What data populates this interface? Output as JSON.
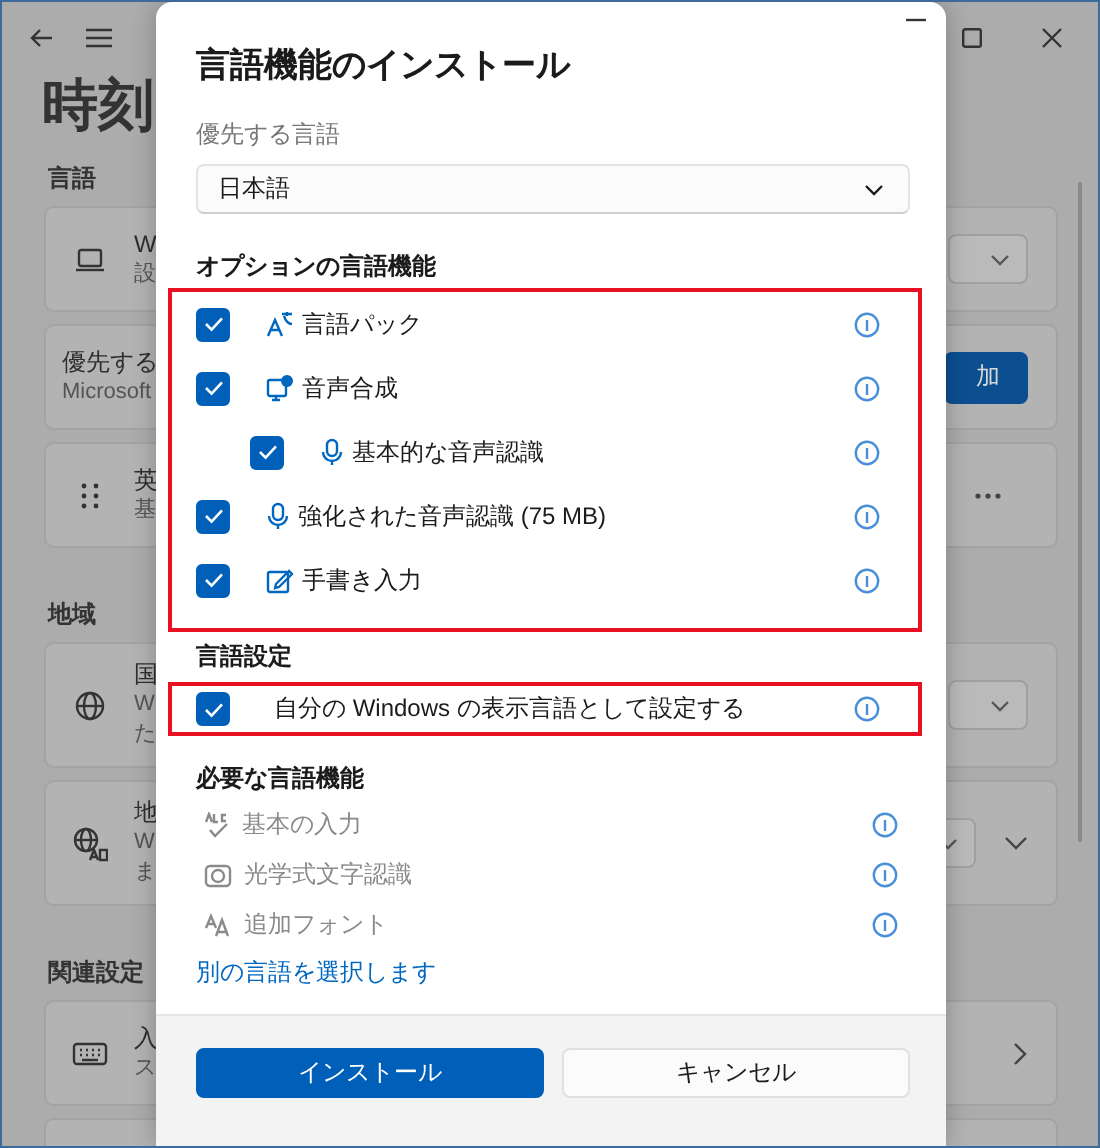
{
  "background": {
    "page_title": "時刻",
    "sections": [
      {
        "heading": "言語",
        "cards": [
          {
            "title": "W",
            "subtitle": "設",
            "kind": "dropdown"
          },
          {
            "title": "優先する",
            "subtitle": "Microsoft",
            "kind": "button",
            "button_label": "加"
          },
          {
            "title": "英",
            "subtitle": "基",
            "kind": "more"
          }
        ]
      },
      {
        "heading": "地域",
        "cards": [
          {
            "title": "国",
            "subtitle": "W",
            "subtitle_2": "た",
            "kind": "dropdown"
          },
          {
            "title": "地",
            "subtitle": "W",
            "subtitle_2": "ま",
            "kind": "dropdown_expand"
          }
        ]
      },
      {
        "heading": "関連設定",
        "cards": [
          {
            "title": "入",
            "subtitle": "ス",
            "kind": "chevron"
          },
          {
            "kind": "plain"
          }
        ]
      }
    ]
  },
  "dialog": {
    "title": "言語機能のインストール",
    "preferred_language": {
      "label": "優先する言語",
      "value": "日本語"
    },
    "optional_features": {
      "heading": "オプションの言語機能",
      "highlighted": true,
      "items": [
        {
          "label": "言語パック",
          "checked": true
        },
        {
          "label": "音声合成",
          "checked": true,
          "children": [
            {
              "label": "基本的な音声認識",
              "checked": true
            }
          ]
        },
        {
          "label": "強化された音声認識 (75 MB)",
          "checked": true
        },
        {
          "label": "手書き入力",
          "checked": true
        }
      ]
    },
    "language_settings": {
      "heading": "言語設定",
      "highlighted": true,
      "items": [
        {
          "label": "自分の Windows の表示言語として設定する",
          "checked": true
        }
      ]
    },
    "required_features": {
      "heading": "必要な言語機能",
      "items": [
        {
          "label": "基本の入力",
          "disabled": true
        },
        {
          "label": "光学式文字認識",
          "disabled": true
        },
        {
          "label": "追加フォント",
          "disabled": true
        }
      ]
    },
    "link": "別の言語を選択します",
    "buttons": [
      {
        "label": "インストール",
        "kind": "primary"
      },
      {
        "label": "キャンセル",
        "kind": "secondary"
      }
    ]
  }
}
